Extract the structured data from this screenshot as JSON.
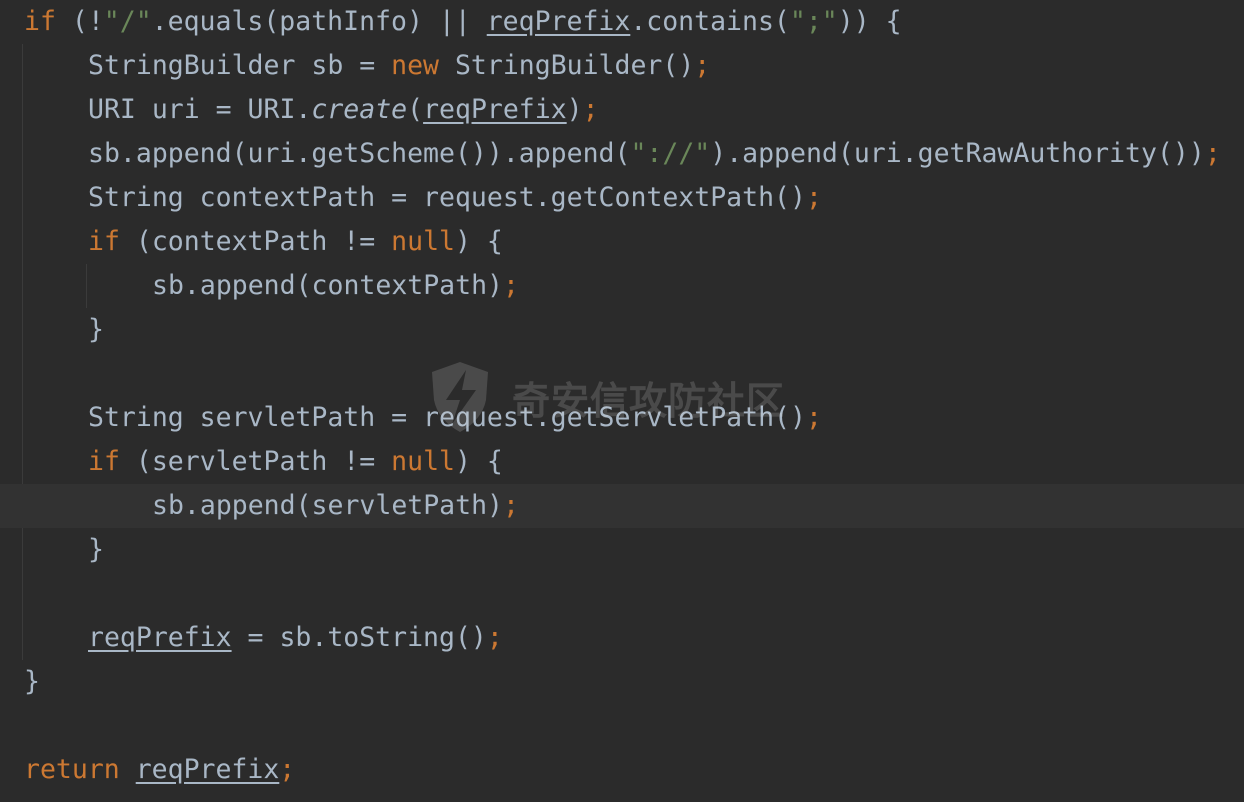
{
  "editor": {
    "lines": [
      {
        "text": "if (!\"/\".equals(pathInfo) || reqPrefix.contains(\";\")) {"
      },
      {
        "text": "StringBuilder sb = new StringBuilder();"
      },
      {
        "text": "URI uri = URI.create(reqPrefix);"
      },
      {
        "text": "sb.append(uri.getScheme()).append(\"://\").append(uri.getRawAuthority());"
      },
      {
        "text": "String contextPath = request.getContextPath();"
      },
      {
        "text": "if (contextPath != null) {"
      },
      {
        "text": "sb.append(contextPath);"
      },
      {
        "text": "}"
      },
      {
        "text": ""
      },
      {
        "text": "String servletPath = request.getServletPath();"
      },
      {
        "text": "if (servletPath != null) {"
      },
      {
        "text": "sb.append(servletPath);"
      },
      {
        "text": "}"
      },
      {
        "text": ""
      },
      {
        "text": "reqPrefix = sb.toString();"
      },
      {
        "text": "}"
      },
      {
        "text": ""
      },
      {
        "text": "return reqPrefix;"
      }
    ]
  },
  "watermark": {
    "text": "奇安信攻防社区",
    "icon": "lightning-shield-icon"
  },
  "colors": {
    "background": "#2b2b2b",
    "current_line": "#323232",
    "default_text": "#a9b7c6",
    "keyword": "#cc7832",
    "string": "#6a8759"
  }
}
